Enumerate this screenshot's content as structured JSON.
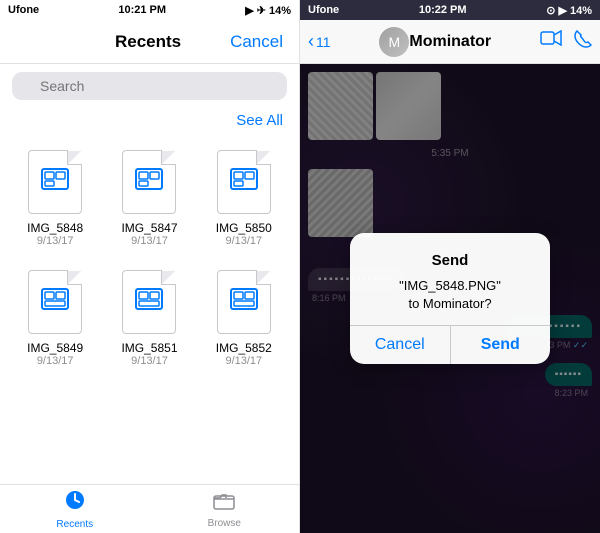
{
  "left": {
    "statusBar": {
      "carrier": "Ufone",
      "time": "10:21 PM",
      "battery": "14%",
      "signal": "▶ ✈ 14%"
    },
    "navBar": {
      "title": "Recents",
      "cancelBtn": "Cancel"
    },
    "searchBar": {
      "placeholder": "Search"
    },
    "seeAll": "See All",
    "files": [
      {
        "name": "IMG_5848",
        "date": "9/13/17"
      },
      {
        "name": "IMG_5847",
        "date": "9/13/17"
      },
      {
        "name": "IMG_5850",
        "date": "9/13/17"
      },
      {
        "name": "IMG_5849",
        "date": "9/13/17"
      },
      {
        "name": "IMG_5851",
        "date": "9/13/17"
      },
      {
        "name": "IMG_5852",
        "date": "9/13/17"
      }
    ],
    "tabs": [
      {
        "label": "Recents",
        "icon": "🕐",
        "active": true
      },
      {
        "label": "Browse",
        "icon": "📁",
        "active": false
      }
    ]
  },
  "right": {
    "statusBar": {
      "carrier": "Ufone",
      "time": "10:22 PM",
      "battery": "14%"
    },
    "navBar": {
      "backCount": "11",
      "title": "Mominator",
      "videoIcon": "📹",
      "callIcon": "📞"
    },
    "messages": [
      {
        "type": "images",
        "time": "5:35 PM"
      },
      {
        "type": "received",
        "text": "...",
        "time": "8:16 PM"
      },
      {
        "type": "sent",
        "text": "...",
        "time": "8:23 PM",
        "check": "✓✓"
      },
      {
        "type": "sent",
        "text": "...",
        "time": "8:23 PM"
      }
    ],
    "dialog": {
      "title": "Send",
      "filename": "\"IMG_5848.PNG\"",
      "recipient": "to Mominator?",
      "cancelBtn": "Cancel",
      "sendBtn": "Send"
    }
  }
}
